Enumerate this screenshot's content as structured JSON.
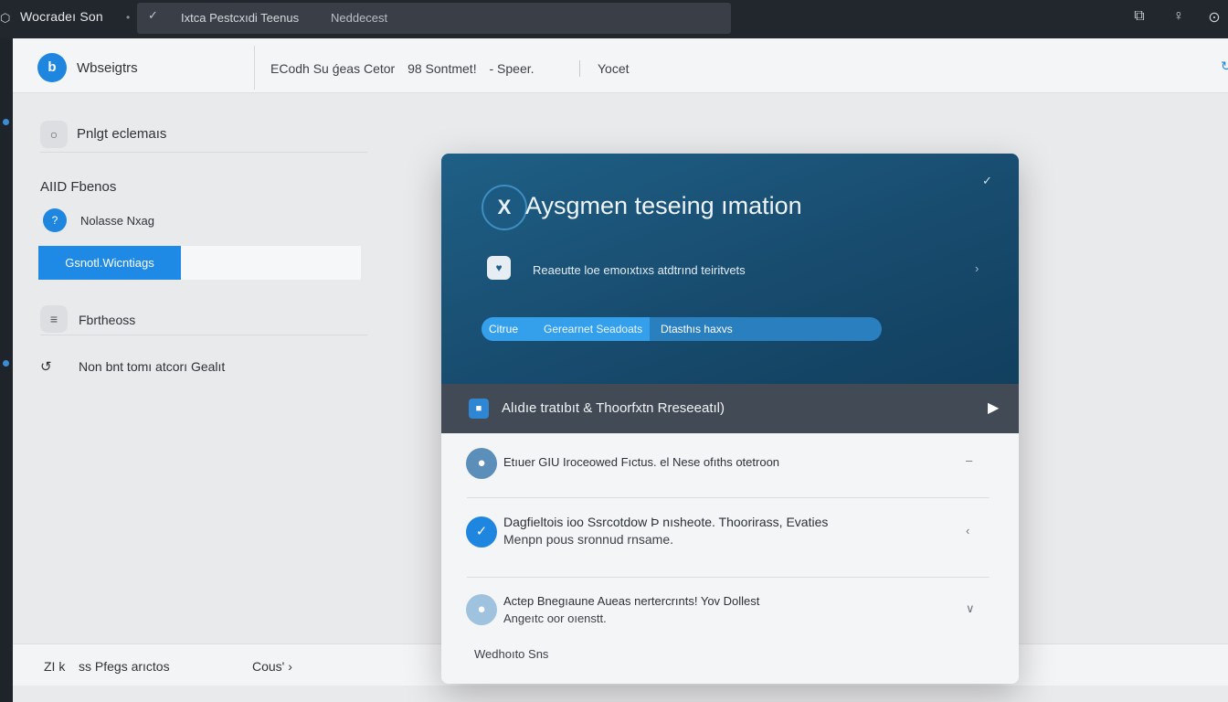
{
  "topbar": {
    "app_icon": "app-logo-icon",
    "app_title": "Wocradeı  Son",
    "search_left": "Ixtca Pestcxıdi  Teenus",
    "search_right": "Neddecest",
    "icons": [
      "window-icon",
      "microphone-icon",
      "power-icon"
    ],
    "icon_glyphs": [
      "⧉",
      "♀",
      "⊙"
    ]
  },
  "header": {
    "logo_text": "b",
    "brand": "Wbseigtrs",
    "crumbs": [
      "ECodh  Su ǵeas Cetor",
      "98 Sontmet!",
      "- Speer."
    ],
    "extra": "Yocet",
    "edge_glyph": "↻"
  },
  "left_panel": {
    "section1_label": "Pnlgt eclemaıs",
    "section1_icon": "○",
    "group_label": "AIID Fbenos",
    "radio_label": "Nolasse Nxag",
    "radio_glyph": "?",
    "active_item": "Gsnotl.Wicntiags",
    "section2_label": "Fbrtheoss",
    "section2_icon": "≡",
    "link_label": "Non bnt tomı atcorı Gealıt",
    "link_icon": "↺"
  },
  "footer": {
    "item1": "ZI k",
    "item2": "ss  Pfegs arıctos",
    "item3": "Cous'  ›"
  },
  "modal": {
    "hero": {
      "badge": "X",
      "title": "Aysgmen teseing ımation",
      "corner_glyph": "✓",
      "subtitle_icon": "♥",
      "subtitle": "Reaeutte loe emoıxtıxs atdtrınd teiritvets",
      "subtitle_chev": "›",
      "progress": {
        "value": 0.42,
        "label1": "Citrue",
        "label2": "Gerearnet Seadoats",
        "label3": "Dtasthıs haxvs"
      }
    },
    "band": {
      "icon": "■",
      "text": "Alıdıe tratıbıt & Thoorfxtn Rreseeatıl)",
      "arrow": "▶"
    },
    "rows": [
      {
        "icon": "●",
        "color": "#5b8fba",
        "title": "Etıuer GIU  Iroceowed Fıctus.  el Nese ofıths otetroon",
        "sub": "",
        "chev": "–"
      },
      {
        "icon": "✓",
        "color": "#1f86e0",
        "title": "Dagfieltois ioo Ssrcotdow  Þ nısheote.  Thoorirass,  Evaties",
        "sub": "Menpn pous sronnud rnsame.",
        "chev": "‹"
      },
      {
        "icon": "●",
        "color": "#9fc3de",
        "title": "Actep Bnegıaune Aueas nertercrınts!  Yov Dollest",
        "sub": "Angeıtc  oor oıenstt.",
        "chev": "∨"
      }
    ],
    "footer_label": "Wedhoıto Sns"
  },
  "colors": {
    "accent": "#1f86e0",
    "hero": "#1a5378",
    "band": "#424a55",
    "topbar": "#22272e"
  }
}
